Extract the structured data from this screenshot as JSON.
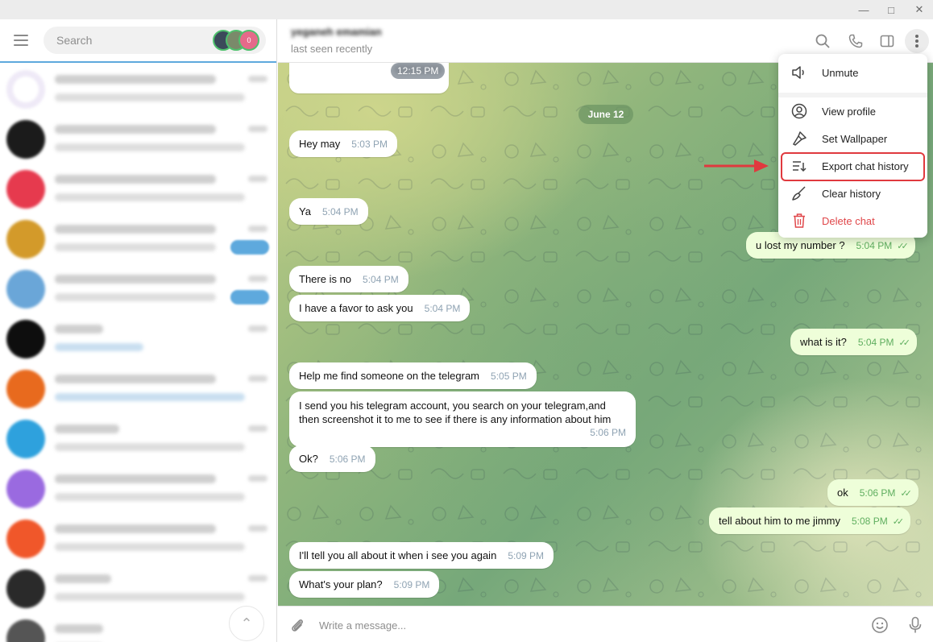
{
  "left_panel": {
    "search_placeholder": "Search",
    "story_count": "0"
  },
  "chat": {
    "contact_name": "yeganeh emamian",
    "status": "last seen recently",
    "date_separator": "June 12",
    "media_time": "12:15 PM",
    "messages": [
      {
        "dir": "in",
        "text": "Hey may",
        "time": "5:03 PM"
      },
      {
        "dir": "in",
        "text": "Ya",
        "time": "5:04 PM"
      },
      {
        "dir": "out",
        "text": "u lost my number ?",
        "time": "5:04 PM"
      },
      {
        "dir": "in",
        "text": "There is no",
        "time": "5:04 PM"
      },
      {
        "dir": "in",
        "text": "I have a favor to ask you",
        "time": "5:04 PM"
      },
      {
        "dir": "out",
        "text": "what is it?",
        "time": "5:04 PM"
      },
      {
        "dir": "in",
        "text": "Help me find someone on the telegram",
        "time": "5:05 PM"
      },
      {
        "dir": "in",
        "text": "I send you his telegram account, you search on your telegram,and then screenshot it to me to see if there is any information about him",
        "time": "5:06 PM"
      },
      {
        "dir": "in",
        "text": "Ok?",
        "time": "5:06 PM"
      },
      {
        "dir": "out",
        "text": "ok",
        "time": "5:06 PM"
      },
      {
        "dir": "out",
        "text": "tell about him to me jimmy",
        "time": "5:08 PM"
      },
      {
        "dir": "in",
        "text": "I'll tell you all about it when i see you again",
        "time": "5:09 PM"
      },
      {
        "dir": "in",
        "text": "What's your plan?",
        "time": "5:09 PM"
      }
    ],
    "input_placeholder": "Write a message..."
  },
  "menu": {
    "items": [
      {
        "label": "Unmute",
        "icon": "speaker-icon"
      },
      {
        "label": "View profile",
        "icon": "profile-icon"
      },
      {
        "label": "Set Wallpaper",
        "icon": "brush-icon"
      },
      {
        "label": "Export chat history",
        "icon": "export-icon"
      },
      {
        "label": "Clear history",
        "icon": "broom-icon"
      },
      {
        "label": "Delete chat",
        "icon": "trash-icon"
      }
    ]
  },
  "colors": {
    "accent": "#5ea9dd",
    "outgoing_bubble": "#eefed9",
    "danger": "#e0474a",
    "highlight": "#e0393e"
  }
}
